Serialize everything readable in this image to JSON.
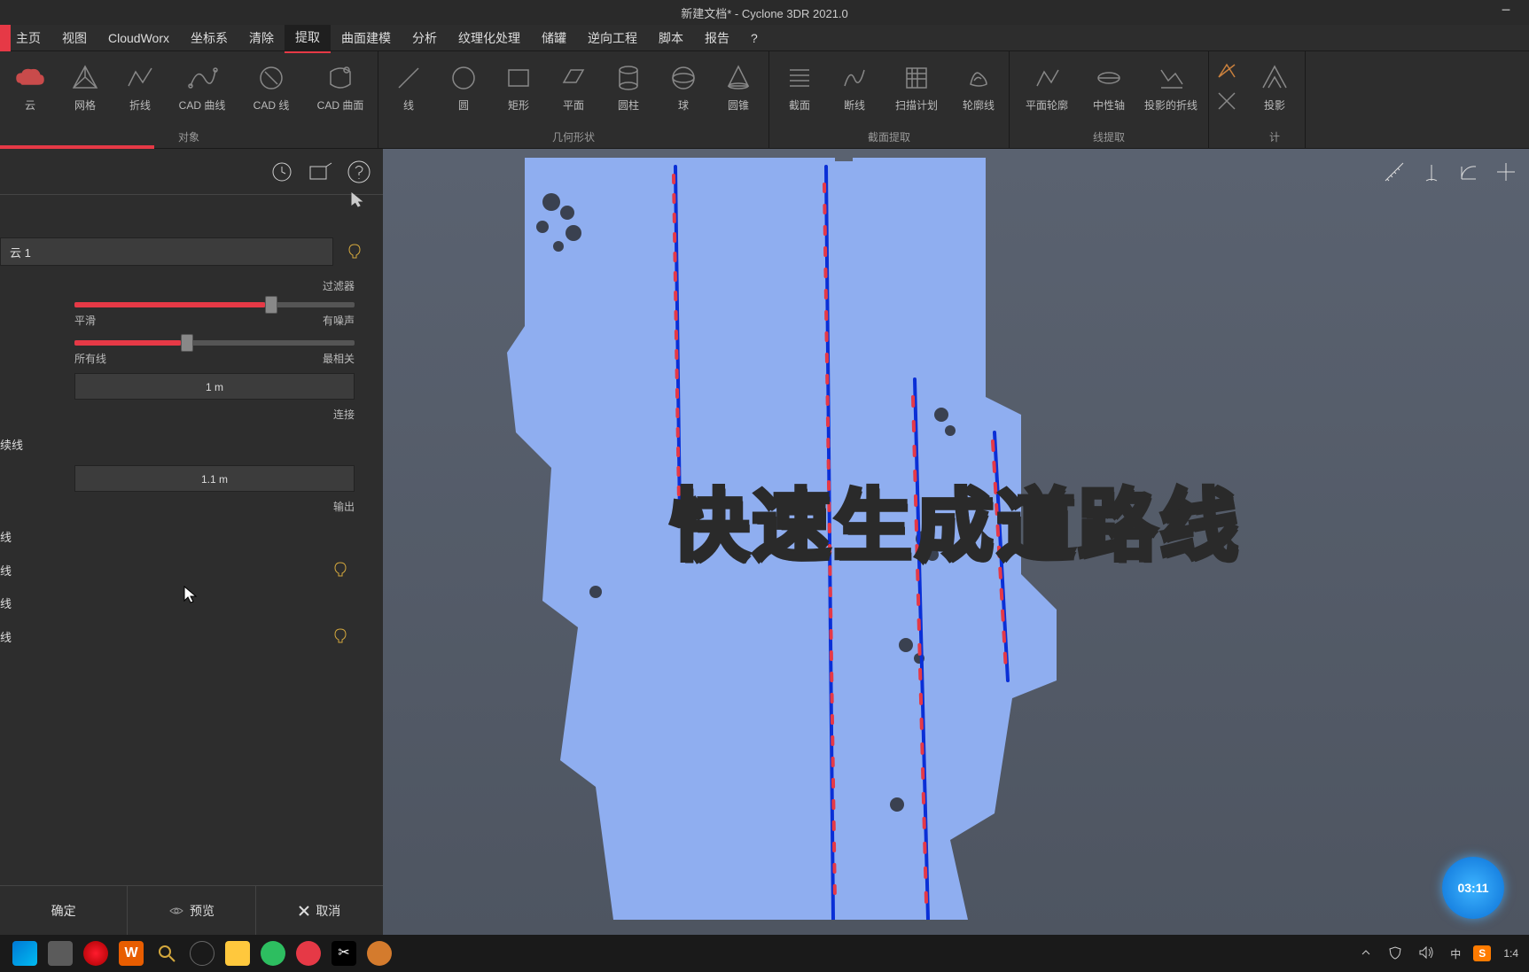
{
  "title": "新建文档* - Cyclone 3DR 2021.0",
  "menu": {
    "items": [
      "主页",
      "视图",
      "CloudWorx",
      "坐标系",
      "清除",
      "提取",
      "曲面建模",
      "分析",
      "纹理化处理",
      "储罐",
      "逆向工程",
      "脚本",
      "报告",
      "?"
    ],
    "active_index": 5
  },
  "ribbon": {
    "groups": [
      {
        "label": "对象",
        "items": [
          "云",
          "网格",
          "折线",
          "CAD 曲线",
          "CAD 线",
          "CAD 曲面"
        ]
      },
      {
        "label": "几何形状",
        "items": [
          "线",
          "圆",
          "矩形",
          "平面",
          "圆柱",
          "球",
          "圆锥"
        ]
      },
      {
        "label": "截面提取",
        "items": [
          "截面",
          "断线",
          "扫描计划",
          "轮廓线"
        ]
      },
      {
        "label": "线提取",
        "items": [
          "平面轮廓",
          "中性轴",
          "投影的折线"
        ]
      },
      {
        "label": "计",
        "items": [
          "投影"
        ]
      }
    ]
  },
  "panel": {
    "input_value": "云 1",
    "filter_section": "过滤器",
    "slider1": {
      "left": "平滑",
      "right": "有噪声",
      "position": 68
    },
    "slider2": {
      "left": "所有线",
      "right": "最相关",
      "position": 38
    },
    "value1": "1 m",
    "connect_section": "连接",
    "option_line1": "续线",
    "value2": "1.1 m",
    "output_section": "输出",
    "output_items": [
      "线",
      "线",
      "线",
      "线"
    ],
    "footer": {
      "ok": "确定",
      "preview": "预览",
      "cancel": "取消"
    }
  },
  "overlay": "快速生成道路线",
  "timer": "03:11",
  "taskbar": {
    "time": "1:4",
    "ime": "中",
    "sogou": "S"
  }
}
